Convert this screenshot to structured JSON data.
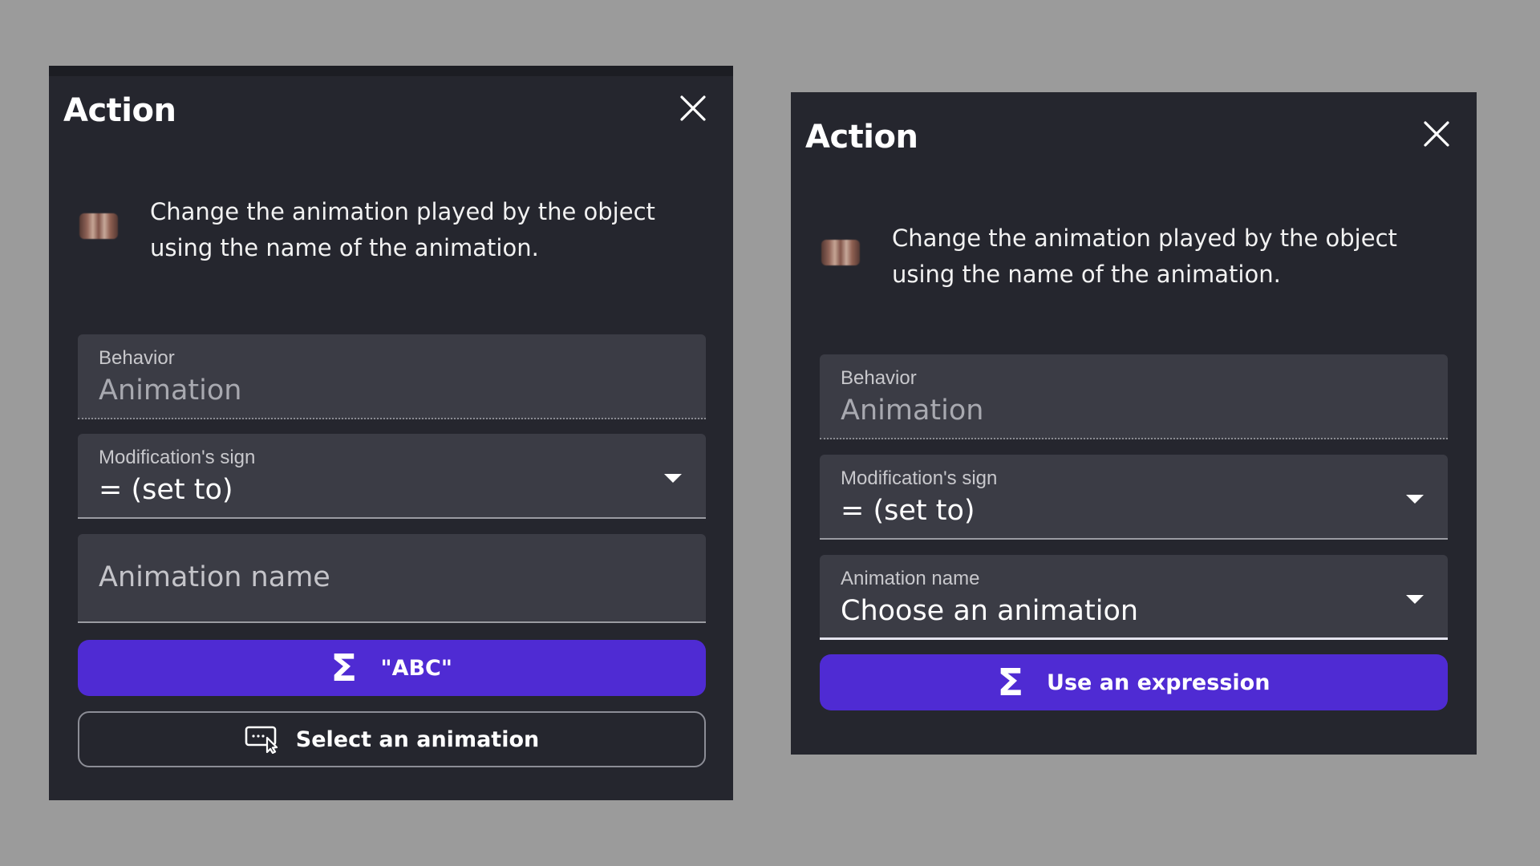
{
  "left_dialog": {
    "title": "Action",
    "close_icon": "close-icon",
    "description": "Change the animation played by the object\nusing the name of the animation.",
    "behavior_field": {
      "label": "Behavior",
      "value": "Animation"
    },
    "sign_field": {
      "label": "Modification's sign",
      "value": "= (set to)"
    },
    "animation_field": {
      "placeholder": "Animation name"
    },
    "expression_button": {
      "icon": "sigma-icon",
      "label": "\"ABC\""
    },
    "select_button": {
      "icon": "cursor-select-icon",
      "label": "Select an animation"
    }
  },
  "right_dialog": {
    "title": "Action",
    "close_icon": "close-icon",
    "description": "Change the animation played by the object\nusing the name of the animation.",
    "behavior_field": {
      "label": "Behavior",
      "value": "Animation"
    },
    "sign_field": {
      "label": "Modification's sign",
      "value": "= (set to)"
    },
    "animation_field": {
      "label": "Animation name",
      "value": "Choose an animation"
    },
    "expression_button": {
      "icon": "sigma-icon",
      "label": "Use an expression"
    }
  },
  "colors": {
    "background": "#9b9b9b",
    "panel": "#25262e",
    "field": "#3b3c45",
    "primary_button": "#4f2bd3"
  }
}
